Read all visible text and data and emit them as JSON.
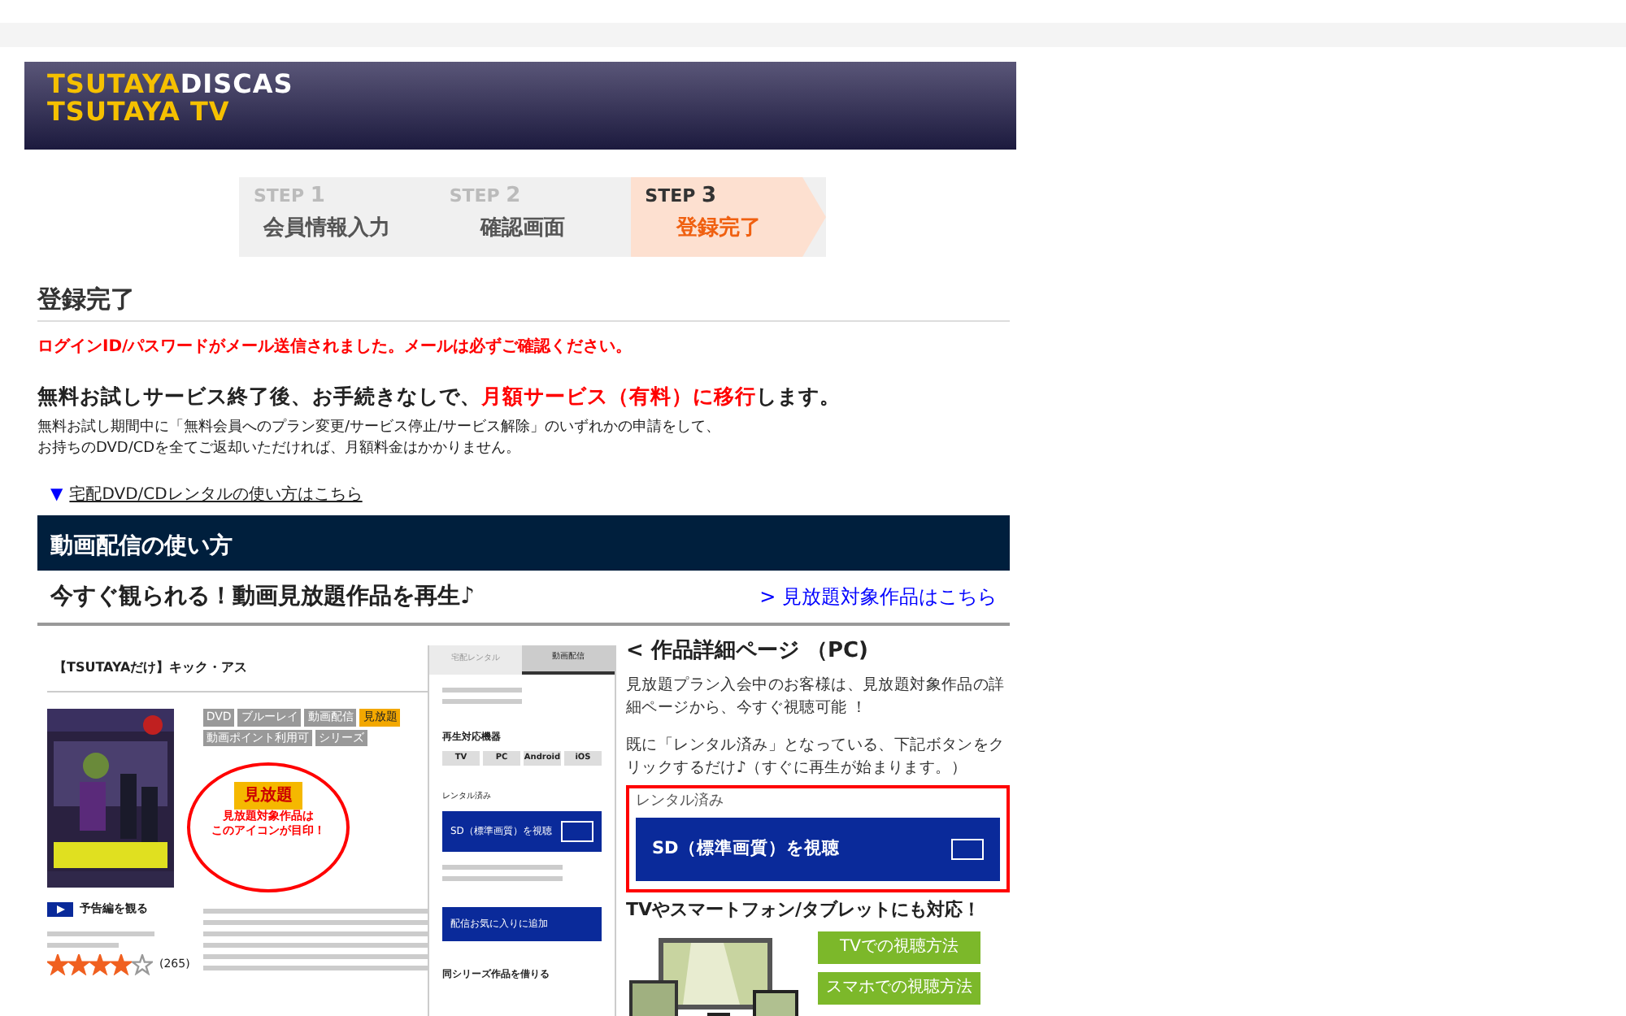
{
  "header": {
    "logo_brand": "TSUTAYA",
    "logo_service": "DISCAS",
    "logo_tv": "TSUTAYA TV"
  },
  "steps": [
    {
      "label": "STEP",
      "number": "1",
      "name": "会員情報入力",
      "selected": false
    },
    {
      "label": "STEP",
      "number": "2",
      "name": "確認画面",
      "selected": false
    },
    {
      "label": "STEP",
      "number": "3",
      "name": "登録完了",
      "selected": true
    }
  ],
  "heading": "登録完了",
  "notice": "ログインID/パスワードがメール送信されました。メールは必ずご確認ください。",
  "lead_parts": [
    {
      "text": "無料お試しサービス終了後、お手続きなしで、",
      "highlight": false
    },
    {
      "text": "月額サービス（有料）に移行",
      "highlight": true
    },
    {
      "text": "します。",
      "highlight": false
    }
  ],
  "note_lines": [
    "無料お試し期間中に「無料会員へのプラン変更/サービス停止/サービス解除」のいずれかの申請をして、",
    "お持ちのDVD/CDを全てご返却いただければ、月額料金はかかりません。"
  ],
  "dvd_link": {
    "marker": "▼",
    "label": "宅配DVD/CDレンタルの使い方はこちら"
  },
  "section_title": "動画配信の使い方",
  "subheading": "今すぐ観られる！動画見放題作品を再生♪",
  "subheading_link": "> 見放題対象作品はこちら",
  "screenshot": {
    "title": "【TSUTAYAだけ】キック・アス",
    "tags": [
      {
        "label": "DVD",
        "selected": false
      },
      {
        "label": "ブルーレイ",
        "selected": false
      },
      {
        "label": "動画配信",
        "selected": false
      },
      {
        "label": "見放題",
        "selected": true
      },
      {
        "label": "動画ポイント利用可",
        "selected": false
      },
      {
        "label": "シリーズ",
        "selected": false
      }
    ],
    "callout_badge": "見放題",
    "callout_lines": [
      "見放題対象作品は",
      "このアイコンが目印！"
    ],
    "trailer": "予告編を観る",
    "stars": 4,
    "review_count": "(265)",
    "tabs": [
      {
        "label": "宅配レンタル",
        "selected": false
      },
      {
        "label": "動画配信",
        "selected": true
      }
    ],
    "devices_title": "再生対応機器",
    "devices": [
      "TV",
      "PC",
      "Android",
      "iOS"
    ],
    "rented_label": "レンタル済み",
    "watch_button": "SD（標準画質）を視聴",
    "favorite_button": "配信お気に入りに追加",
    "series_title": "同シリーズ作品を借りる"
  },
  "guide": {
    "title": "< 作品詳細ページ （PC)",
    "paragraphs": [
      "見放題プラン入会中のお客様は、見放題対象作品の詳細ページから、今すぐ視聴可能 ！",
      "既に「レンタル済み」となっている、下記ボタンをクリックするだけ♪（すぐに再生が始まります。）"
    ],
    "rented_label": "レンタル済み",
    "watch_button": "SD（標準画質）を視聴",
    "devices_title": "TVやスマートフォン/タブレットにも対応！",
    "device_buttons": [
      "TVでの視聴方法",
      "スマホでの視聴方法"
    ]
  }
}
